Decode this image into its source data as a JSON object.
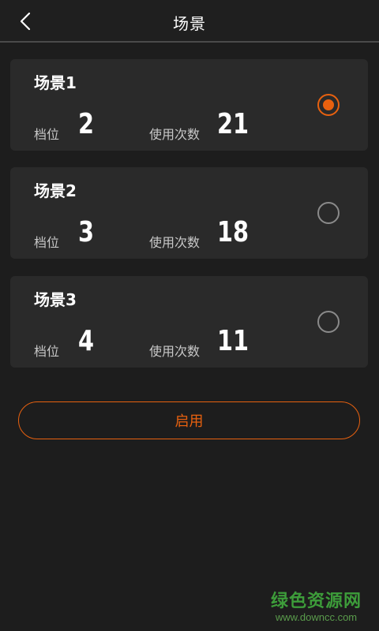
{
  "header": {
    "title": "场景"
  },
  "scenes": [
    {
      "name": "场景1",
      "gear_label": "档位",
      "gear_value": "2",
      "count_label": "使用次数",
      "count_value": "21",
      "selected": true
    },
    {
      "name": "场景2",
      "gear_label": "档位",
      "gear_value": "3",
      "count_label": "使用次数",
      "count_value": "18",
      "selected": false
    },
    {
      "name": "场景3",
      "gear_label": "档位",
      "gear_value": "4",
      "count_label": "使用次数",
      "count_value": "11",
      "selected": false
    }
  ],
  "actions": {
    "enable_label": "启用"
  },
  "watermark": {
    "main": "绿色资源网",
    "sub": "www.downcc.com"
  },
  "colors": {
    "accent": "#e8610f",
    "background": "#1d1d1d",
    "card": "#2a2a2a"
  },
  "icons": {
    "back": "chevron-left-icon",
    "radio_on": "radio-selected-icon",
    "radio_off": "radio-unselected-icon"
  }
}
